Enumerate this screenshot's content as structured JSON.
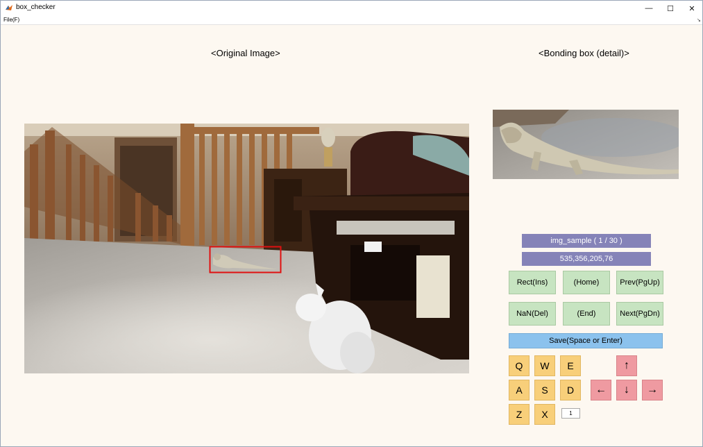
{
  "window": {
    "title": "box_checker",
    "min_glyph": "—",
    "max_glyph": "☐",
    "close_glyph": "✕"
  },
  "menu": {
    "file": "File(F)",
    "dock_glyph": "↘"
  },
  "headings": {
    "original": "<Original Image>",
    "detail": "<Bonding box (detail)>"
  },
  "info": {
    "image_name": "img_sample ( 1 / 30 )",
    "box_coords": "535,356,205,76"
  },
  "buttons": {
    "rect": "Rect(Ins)",
    "home": "(Home)",
    "prev": "Prev(PgUp)",
    "nan": "NaN(Del)",
    "end": "(End)",
    "next": "Next(PgDn)",
    "save": "Save(Space or Enter)"
  },
  "keys": {
    "q": "Q",
    "w": "W",
    "e": "E",
    "a": "A",
    "s": "S",
    "d": "D",
    "z": "Z",
    "x": "X"
  },
  "arrows": {
    "up": "↑",
    "left": "←",
    "down": "↓",
    "right": "→"
  },
  "step": {
    "value": "1"
  },
  "colors": {
    "background": "#fdf8f1",
    "info_bar": "#8583b8",
    "green_button": "#c7e4c1",
    "save_button": "#8bc2ed",
    "key_button": "#f8cf7a",
    "arrow_button": "#ef9aa1",
    "bbox": "#e01010"
  },
  "icons": {
    "app": "matlab-icon",
    "dock": "undock-icon"
  }
}
